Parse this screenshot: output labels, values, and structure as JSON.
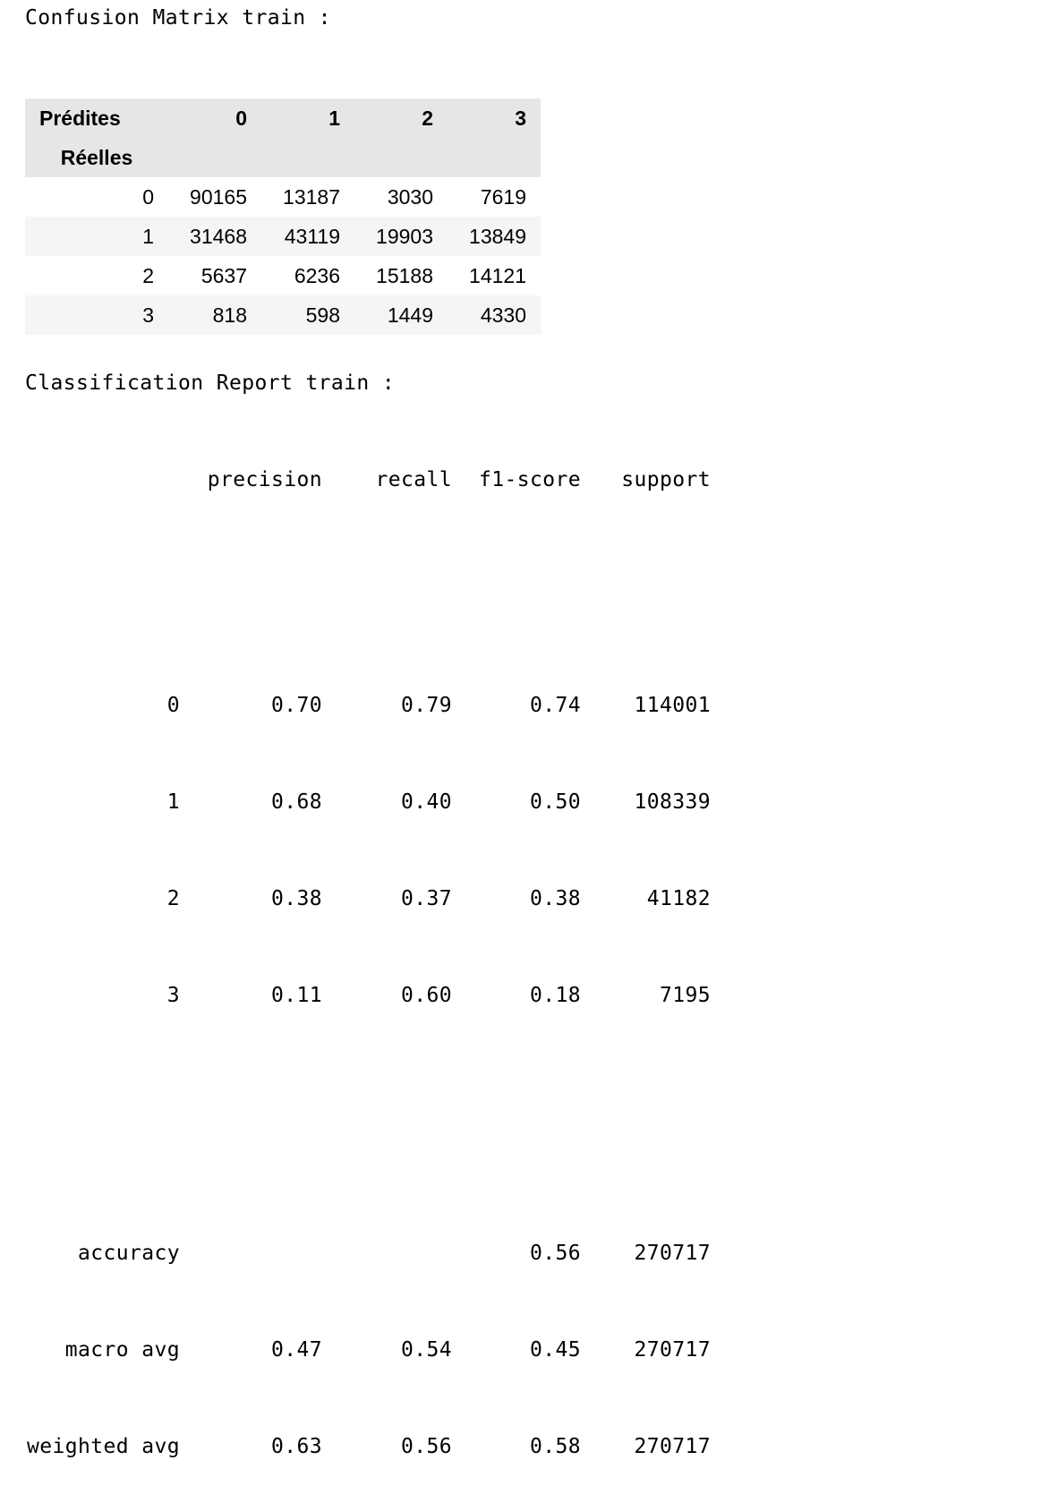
{
  "confusion_matrix": {
    "heading": "Confusion Matrix train :",
    "columns_name": "Prédites",
    "index_name": "Réelles",
    "columns": [
      "0",
      "1",
      "2",
      "3"
    ],
    "rows": [
      {
        "label": "0",
        "values": [
          "90165",
          "13187",
          "3030",
          "7619"
        ]
      },
      {
        "label": "1",
        "values": [
          "31468",
          "43119",
          "19903",
          "13849"
        ]
      },
      {
        "label": "2",
        "values": [
          "5637",
          "6236",
          "15188",
          "14121"
        ]
      },
      {
        "label": "3",
        "values": [
          "818",
          "598",
          "1449",
          "4330"
        ]
      }
    ]
  },
  "classification_report": {
    "heading": "Classification Report train :",
    "headers": {
      "precision": "precision",
      "recall": "recall",
      "f1": "f1-score",
      "support": "support"
    },
    "class_rows": [
      {
        "label": "0",
        "precision": "0.70",
        "recall": "0.79",
        "f1": "0.74",
        "support": "114001"
      },
      {
        "label": "1",
        "precision": "0.68",
        "recall": "0.40",
        "f1": "0.50",
        "support": "108339"
      },
      {
        "label": "2",
        "precision": "0.38",
        "recall": "0.37",
        "f1": "0.38",
        "support": "41182"
      },
      {
        "label": "3",
        "precision": "0.11",
        "recall": "0.60",
        "f1": "0.18",
        "support": "7195"
      }
    ],
    "summary_rows": [
      {
        "label": "accuracy",
        "precision": "",
        "recall": "",
        "f1": "0.56",
        "support": "270717"
      },
      {
        "label": "macro avg",
        "precision": "0.47",
        "recall": "0.54",
        "f1": "0.45",
        "support": "270717"
      },
      {
        "label": "weighted avg",
        "precision": "0.63",
        "recall": "0.56",
        "f1": "0.58",
        "support": "270717"
      }
    ]
  }
}
